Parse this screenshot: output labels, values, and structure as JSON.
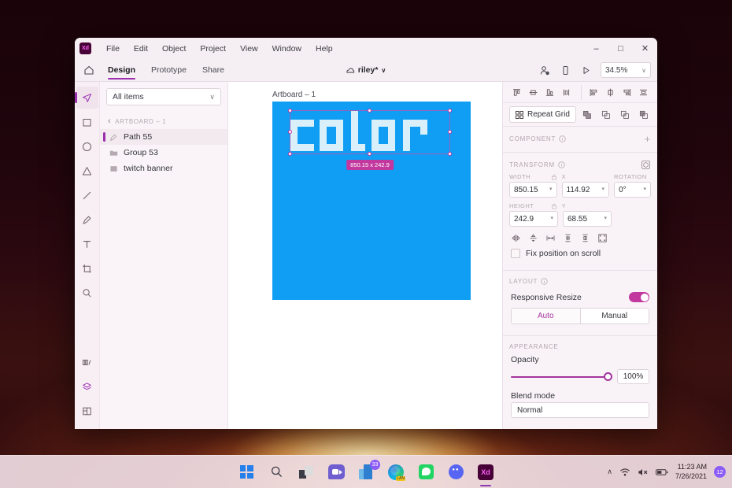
{
  "window": {
    "app_name": "Xd",
    "menu": [
      "File",
      "Edit",
      "Object",
      "Project",
      "View",
      "Window",
      "Help"
    ],
    "controls": {
      "minimize": "–",
      "maximize": "□",
      "close": "✕"
    }
  },
  "tabs": {
    "items": [
      {
        "label": "Design",
        "active": true
      },
      {
        "label": "Prototype",
        "active": false
      },
      {
        "label": "Share",
        "active": false
      }
    ],
    "doc_title": "riley*",
    "zoom_level": "34.5%",
    "home_icon": "home-icon",
    "cloud_icon": "cloud-icon",
    "chevron": "∨"
  },
  "toolrail": [
    {
      "name": "select-tool",
      "icon": "cursor-icon",
      "active": true
    },
    {
      "name": "rectangle-tool",
      "icon": "rectangle-icon",
      "active": false
    },
    {
      "name": "ellipse-tool",
      "icon": "ellipse-icon",
      "active": false
    },
    {
      "name": "polygon-tool",
      "icon": "triangle-icon",
      "active": false
    },
    {
      "name": "line-tool",
      "icon": "line-icon",
      "active": false
    },
    {
      "name": "pen-tool",
      "icon": "pen-icon",
      "active": false
    },
    {
      "name": "text-tool",
      "icon": "text-icon",
      "active": false
    },
    {
      "name": "artboard-tool",
      "icon": "crop-icon",
      "active": false
    },
    {
      "name": "zoom-tool",
      "icon": "magnifier-icon",
      "active": false
    }
  ],
  "toolrail_bottom": [
    {
      "name": "assets-panel",
      "icon": "columns-icon",
      "active": false
    },
    {
      "name": "layers-panel",
      "icon": "layers-icon",
      "active": true
    },
    {
      "name": "plugins-panel",
      "icon": "grid-icon",
      "active": false
    }
  ],
  "layers": {
    "filter_value": "All items",
    "breadcrumb": "ARTBOARD – 1",
    "back_chevron": "‹",
    "items": [
      {
        "label": "Path 55",
        "icon": "path-icon",
        "selected": true
      },
      {
        "label": "Group 53",
        "icon": "folder-icon",
        "selected": false
      },
      {
        "label": "twitch banner",
        "icon": "image-icon",
        "selected": false
      }
    ]
  },
  "canvas": {
    "artboard_label": "Artboard – 1",
    "artboard_color": "#0f9ef4",
    "selection_dimensions": "850.15 x 242.9",
    "glyph_text": "color",
    "glyph_color": "#d9f0fb",
    "selection_color": "#9b5fc0",
    "handle_color": "#c2389f"
  },
  "properties": {
    "align_icons": [
      "align-top-icon",
      "align-vertical-center-icon",
      "align-bottom-icon",
      "align-vertical-alt-icon",
      "align-left-icon",
      "align-horizontal-center-icon",
      "align-right-icon",
      "align-justify-icon"
    ],
    "repeat_grid_label": "Repeat Grid",
    "boolean_icons": [
      "boolean-add-icon",
      "boolean-subtract-icon",
      "boolean-intersect-icon",
      "boolean-exclude-icon"
    ],
    "component": {
      "title": "COMPONENT",
      "info_icon": "info-icon",
      "add_icon": "+"
    },
    "transform": {
      "title": "TRANSFORM",
      "info_icon": "info-icon",
      "flip_icon": "transform-3d-icon",
      "width_label": "WIDTH",
      "width_value": "850.15",
      "x_label": "X",
      "x_value": "114.92",
      "rotation_label": "ROTATION",
      "rotation_value": "0°",
      "height_label": "HEIGHT",
      "height_value": "242.9",
      "y_label": "Y",
      "y_value": "68.55",
      "lock_icon": "lock-icon",
      "distribute_icons": [
        "flip-horizontal-icon",
        "flip-vertical-icon",
        "distribute-horizontal-icon",
        "corner-radius-icon",
        "corner-radius-alt-icon",
        "all-corners-icon"
      ],
      "fix_position_label": "Fix position on scroll",
      "fix_position_checked": false
    },
    "layout": {
      "title": "LAYOUT",
      "info_icon": "info-icon",
      "responsive_label": "Responsive Resize",
      "responsive_on": true,
      "modes": [
        {
          "label": "Auto",
          "active": true
        },
        {
          "label": "Manual",
          "active": false
        }
      ]
    },
    "appearance": {
      "title": "APPEARANCE",
      "opacity_label": "Opacity",
      "opacity_value": "100%",
      "blend_label": "Blend mode",
      "blend_value": "Normal"
    },
    "accent_color": "#a4349e"
  },
  "taskbar": {
    "items": [
      {
        "name": "start-button",
        "icon": "windows-icon",
        "badge": null,
        "active": false
      },
      {
        "name": "search-button",
        "icon": "search-icon",
        "badge": null,
        "active": false
      },
      {
        "name": "file-explorer",
        "icon": "folder-icon",
        "badge": null,
        "active": false
      },
      {
        "name": "teams-chat",
        "icon": "chat-icon",
        "badge": null,
        "active": false
      },
      {
        "name": "microsoft-store",
        "icon": "store-icon",
        "badge": "33",
        "active": false
      },
      {
        "name": "microsoft-edge",
        "icon": "edge-icon",
        "badge": null,
        "active": false
      },
      {
        "name": "messaging-app",
        "icon": "message-icon",
        "badge": null,
        "active": false
      },
      {
        "name": "discord-app",
        "icon": "discord-icon",
        "badge": null,
        "active": false
      },
      {
        "name": "adobe-xd",
        "icon": "xd-icon",
        "badge": null,
        "active": true
      }
    ],
    "tray": {
      "chevron": "∧",
      "wifi_icon": "wifi-icon",
      "volume_icon": "volume-muted-icon",
      "battery_icon": "battery-icon",
      "time": "11:23 AM",
      "date": "7/26/2021",
      "notification_count": "12"
    }
  }
}
